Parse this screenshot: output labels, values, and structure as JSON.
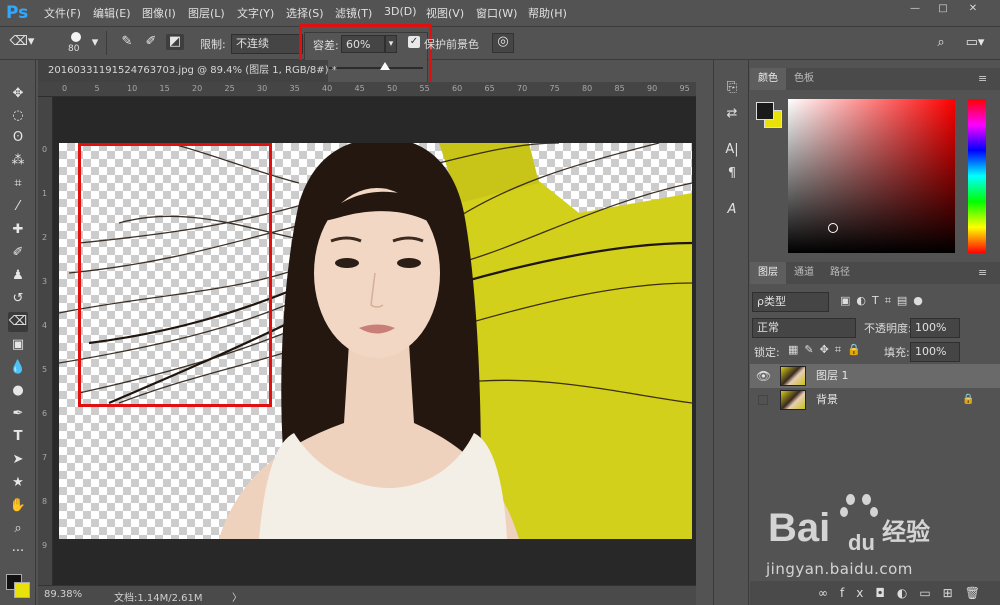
{
  "app": {
    "logo": "Ps"
  },
  "menu": [
    "文件(F)",
    "编辑(E)",
    "图像(I)",
    "图层(L)",
    "文字(Y)",
    "选择(S)",
    "滤镜(T)",
    "3D(D)",
    "视图(V)",
    "窗口(W)",
    "帮助(H)"
  ],
  "window_controls": {
    "minimize": "—",
    "restore": "□",
    "close": "✕"
  },
  "options": {
    "brush_size": "80",
    "limit_label": "限制:",
    "limit_value": "不连续",
    "tolerance_label": "容差:",
    "tolerance_value": "60%",
    "tolerance_slider_fraction": 0.6,
    "protect_fg_label": "保护前景色",
    "protect_fg_checked": true
  },
  "document": {
    "tab_title": "20160331191524763703.jpg @ 89.4% (图层 1, RGB/8#) *",
    "ruler_h": [
      "0",
      "5",
      "10",
      "15",
      "20",
      "25",
      "30",
      "35",
      "40",
      "45",
      "50",
      "55",
      "60",
      "65",
      "70",
      "75",
      "80",
      "85",
      "90",
      "95"
    ],
    "ruler_v": [
      "0",
      "1",
      "2",
      "3",
      "4",
      "5",
      "6",
      "7",
      "8",
      "9"
    ]
  },
  "status": {
    "zoom": "89.38%",
    "doc_info": "文档:1.14M/2.61M",
    "arrow": "〉"
  },
  "color_panel": {
    "tabs": [
      "颜色",
      "色板"
    ],
    "hue_color": "#ff0000",
    "foreground": "#1a1a1a",
    "background": "#e8e20a"
  },
  "layers_panel": {
    "tabs": [
      "图层",
      "通道",
      "路径"
    ],
    "filter_label": "ρ类型",
    "blend_mode": "正常",
    "opacity_label": "不透明度:",
    "opacity_value": "100%",
    "lock_label": "锁定:",
    "fill_label": "填充:",
    "fill_value": "100%",
    "layers": [
      {
        "name": "图层 1",
        "visible": true,
        "selected": true
      },
      {
        "name": "背景",
        "visible": false,
        "locked": true
      }
    ],
    "footer_icons": [
      "link-icon",
      "fx-icon",
      "mask-icon",
      "adjustment-icon",
      "folder-icon",
      "new-layer-icon",
      "trash-icon"
    ]
  },
  "watermark": {
    "brand": "Bai",
    "brand2": "du",
    "cn": "经验",
    "url": "jingyan.baidu.com"
  },
  "colors": {
    "accent_red": "#e01010",
    "ps_blue": "#31a8ff",
    "bg_yellow": "#d2d01a"
  }
}
